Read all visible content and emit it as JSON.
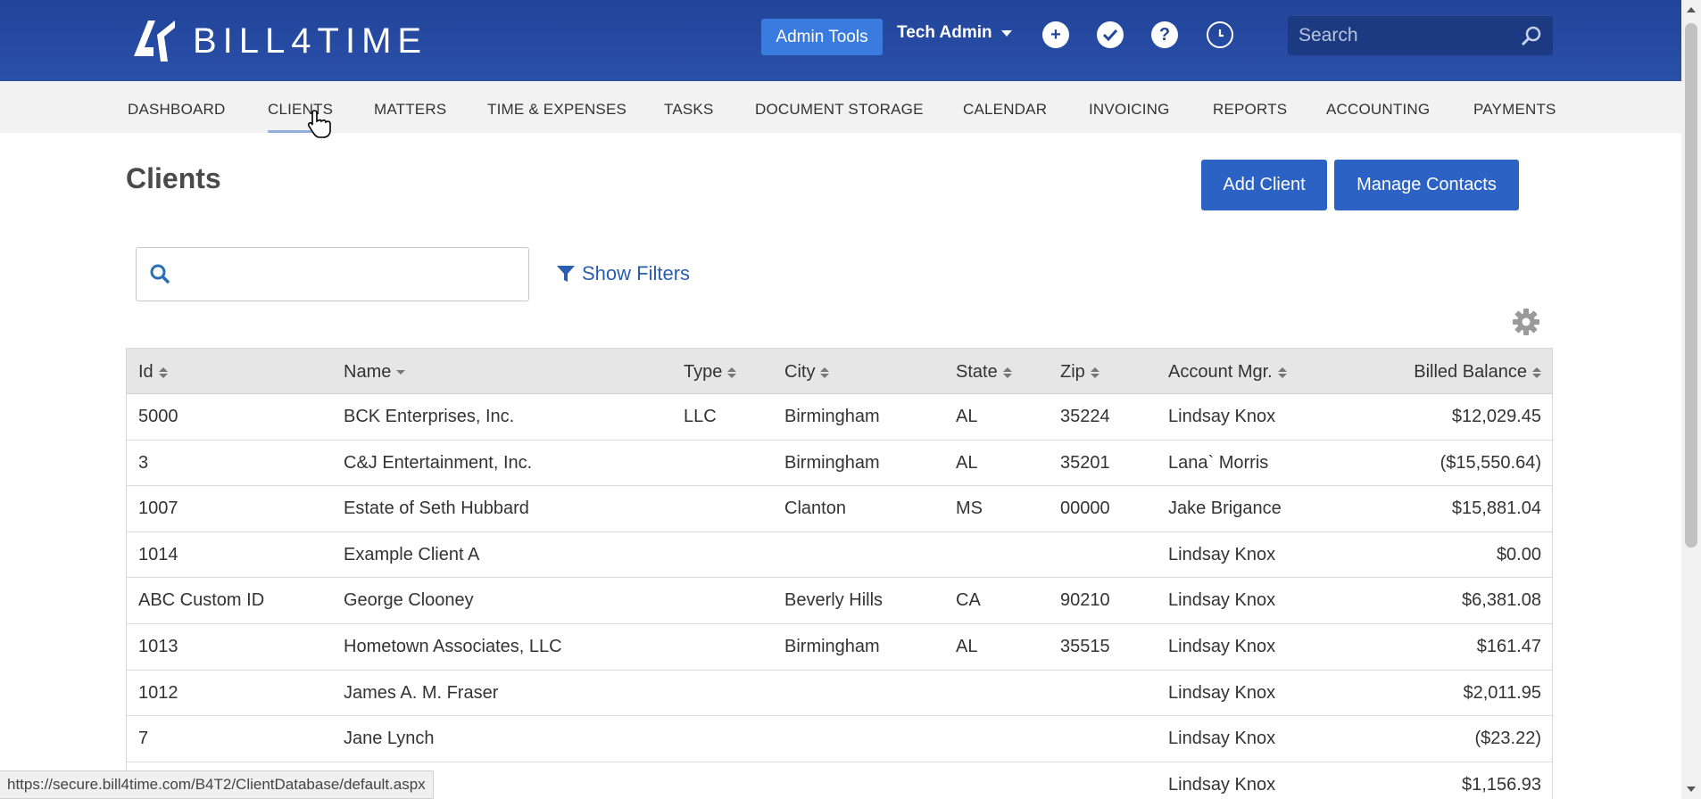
{
  "header": {
    "logo_text": "BILL4TIME",
    "admin_tools_label": "Admin Tools",
    "user_name": "Tech Admin",
    "icons": [
      "add-icon",
      "check-icon",
      "help-icon",
      "clock-icon"
    ],
    "search_placeholder": "Search"
  },
  "nav": {
    "items": [
      "DASHBOARD",
      "CLIENTS",
      "MATTERS",
      "TIME & EXPENSES",
      "TASKS",
      "DOCUMENT STORAGE",
      "CALENDAR",
      "INVOICING",
      "REPORTS",
      "ACCOUNTING",
      "PAYMENTS"
    ],
    "active": "CLIENTS"
  },
  "page": {
    "title": "Clients",
    "add_client_label": "Add Client",
    "manage_contacts_label": "Manage Contacts",
    "show_filters_label": "Show Filters",
    "search_value": ""
  },
  "table": {
    "columns": [
      "Id",
      "Name",
      "Type",
      "City",
      "State",
      "Zip",
      "Account Mgr.",
      "Billed Balance"
    ],
    "rows": [
      [
        "5000",
        "BCK Enterprises, Inc.",
        "LLC",
        "Birmingham",
        "AL",
        "35224",
        "Lindsay Knox",
        "$12,029.45"
      ],
      [
        "3",
        "C&J Entertainment, Inc.",
        "",
        "Birmingham",
        "AL",
        "35201",
        "Lana` Morris",
        "($15,550.64)"
      ],
      [
        "1007",
        "Estate of Seth Hubbard",
        "",
        "Clanton",
        "MS",
        "00000",
        "Jake Brigance",
        "$15,881.04"
      ],
      [
        "1014",
        "Example Client A",
        "",
        "",
        "",
        "",
        "Lindsay Knox",
        "$0.00"
      ],
      [
        "ABC Custom ID",
        "George Clooney",
        "",
        "Beverly Hills",
        "CA",
        "90210",
        "Lindsay Knox",
        "$6,381.08"
      ],
      [
        "1013",
        "Hometown Associates, LLC",
        "",
        "Birmingham",
        "AL",
        "35515",
        "Lindsay Knox",
        "$161.47"
      ],
      [
        "1012",
        "James A. M. Fraser",
        "",
        "",
        "",
        "",
        "Lindsay Knox",
        "$2,011.95"
      ],
      [
        "7",
        "Jane Lynch",
        "",
        "",
        "",
        "",
        "Lindsay Knox",
        "($23.22)"
      ],
      [
        "",
        "",
        "",
        "",
        "",
        "",
        "Lindsay Knox",
        "$1,156.93"
      ]
    ]
  },
  "statusbar": {
    "url": "https://secure.bill4time.com/B4T2/ClientDatabase/default.aspx"
  },
  "colors": {
    "header_bg": "#24479a",
    "primary_button": "#2b62c4",
    "admin_tools_button": "#3a7be0",
    "link": "#2a5db0"
  }
}
